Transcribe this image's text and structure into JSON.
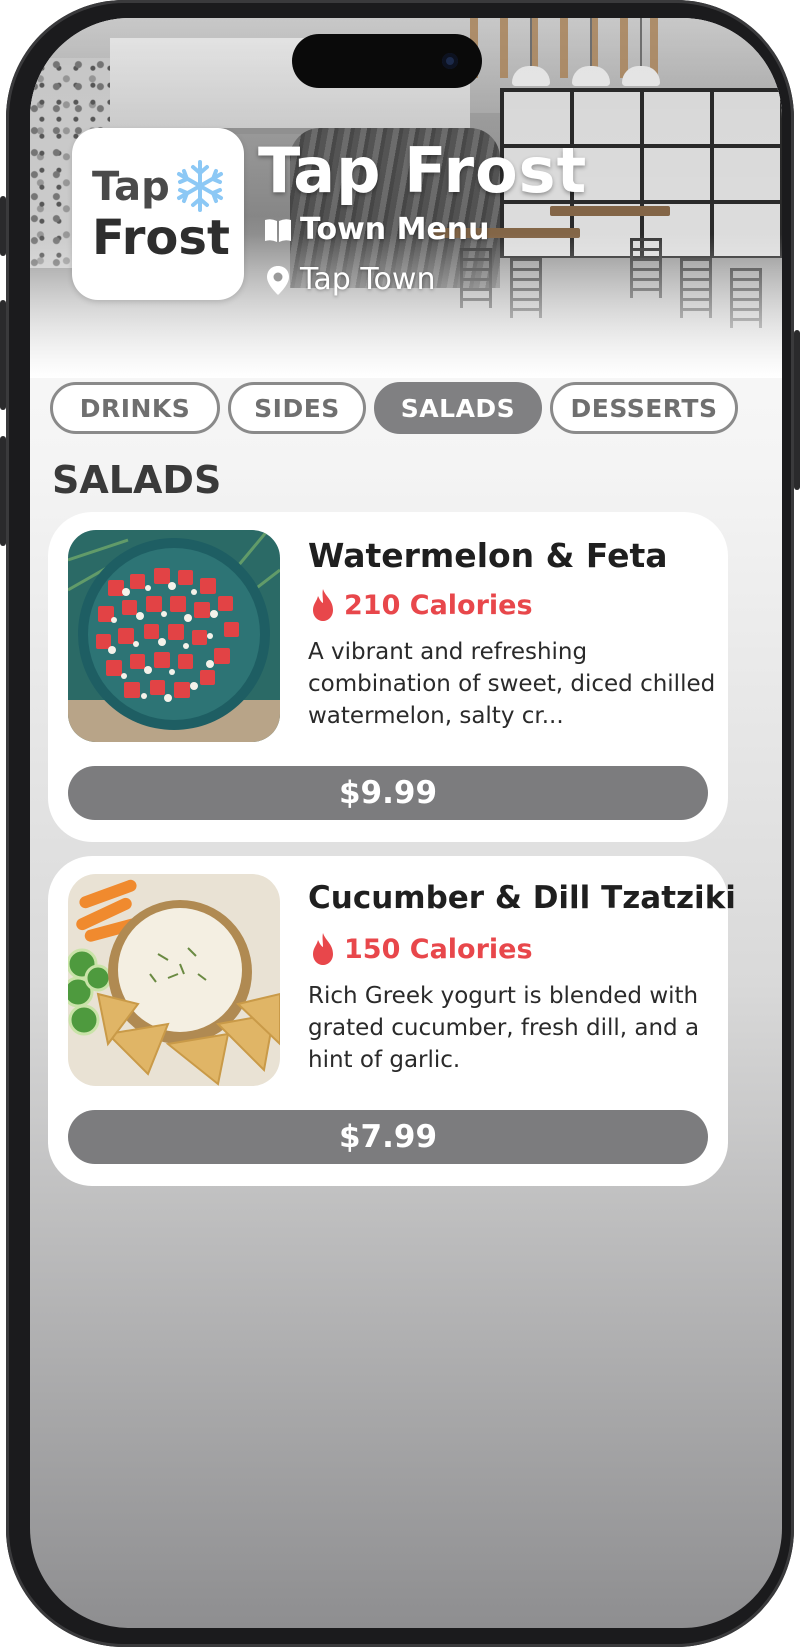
{
  "restaurant": {
    "logo_line1": "Tap",
    "logo_line2": "Frost",
    "name": "Tap Frost",
    "menu_label": "Town Menu",
    "location": "Tap Town"
  },
  "tabs": [
    {
      "label": "DRINKS",
      "active": false
    },
    {
      "label": "SIDES",
      "active": false
    },
    {
      "label": "SALADS",
      "active": true
    },
    {
      "label": "DESSERTS",
      "active": false
    }
  ],
  "section": {
    "title": "SALADS"
  },
  "items": [
    {
      "name": "Watermelon & Feta",
      "calories": "210 Calories",
      "description": "A vibrant and refreshing combination of sweet, diced chilled watermelon, salty cr...",
      "price": "$9.99"
    },
    {
      "name": "Cucumber & Dill Tzatziki",
      "calories": "150 Calories",
      "description": "Rich Greek yogurt is blended with grated cucumber, fresh dill, and a hint of garlic.",
      "price": "$7.99"
    }
  ],
  "colors": {
    "accent_calorie": "#e8474b",
    "active_tab": "#808082",
    "price_button": "#7c7c7e",
    "snowflake": "#8cc8f5"
  },
  "icons": [
    "snowflake-icon",
    "book-icon",
    "location-pin-icon",
    "flame-icon"
  ]
}
